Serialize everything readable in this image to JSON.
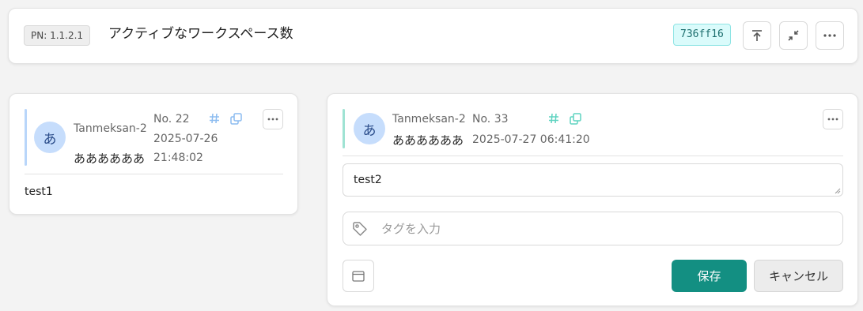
{
  "header": {
    "pn_badge": "PN: 1.1.2.1",
    "title": "アクティブなワークスペース数",
    "hash": "736ff16",
    "actions": [
      "scroll-to-top-icon",
      "collapse-icon",
      "more-icon"
    ]
  },
  "posts": [
    {
      "avatar": "あ",
      "user": "Tanmeksan-2",
      "display_name": "ああああああ",
      "number": "No. 22",
      "date": "2025-07-26",
      "time": "21:48:02",
      "body": "test1",
      "accent_color": "#b9d6fa"
    }
  ],
  "editor": {
    "avatar": "あ",
    "user": "Tanmeksan-2",
    "display_name": "ああああああ",
    "number": "No. 33",
    "datetime": "2025-07-27 06:41:20",
    "text": "test2",
    "tag_placeholder": "タグを入力",
    "save_label": "保存",
    "cancel_label": "キャンセル",
    "accent_color": "#9fe3d3"
  },
  "colors": {
    "primary": "#138f82",
    "hash_bg": "#dafbfb",
    "icon_blue": "#8cbcf0",
    "icon_teal": "#5ed3c0"
  }
}
